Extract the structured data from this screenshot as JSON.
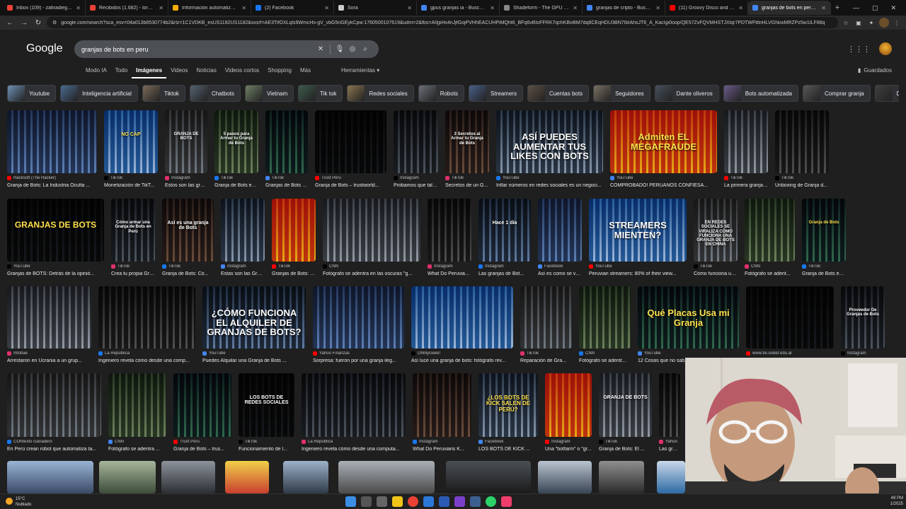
{
  "tabs": [
    {
      "title": "Inbox (109) - zafiradiego23@g",
      "color": "#ea4335",
      "active": false
    },
    {
      "title": "Recibidos (1.682) - lordgarza",
      "color": "#ea4335",
      "active": false
    },
    {
      "title": "Información automatizada de",
      "color": "#f9ab00",
      "active": false
    },
    {
      "title": "(2) Facebook",
      "color": "#1877f2",
      "active": false
    },
    {
      "title": "Sora",
      "color": "#cccccc",
      "active": false
    },
    {
      "title": "gpus granjas ia - Buscar con",
      "color": "#4285f4",
      "active": false
    },
    {
      "title": "Shadeform - The GPU Cloud",
      "color": "#888888",
      "active": false
    },
    {
      "title": "granjas de cripto - Buscar con",
      "color": "#4285f4",
      "active": false
    },
    {
      "title": "(11) Groovy Disco and R&B",
      "color": "#ff0000",
      "active": false
    },
    {
      "title": "granjas de bots en peru - Bus",
      "color": "#4285f4",
      "active": true
    }
  ],
  "toolbar": {
    "url": "google.com/search?sca_esv=04a013b6530774b2&rlz=1C1VDKB_esUS1182US1182&sxsrf=AE3TifOXLqls9WmcHs-gV_vbG5nGEykCpw:1760500107619&udm=2&fbs=AIIjpHx4nJjfGojPVHhEACUHPiMQht6_BFq6vBIoFFRK7qchKBv8lM7dq8CEqHDU3BN7IbIAhsJT8_A_KacIgi0oop/QE57ZvFQVMHSTJXlqr7PDTWFttlnHLVGNoxMRZPz5w1ILF88q"
  },
  "google": {
    "logo": "Google",
    "query": "granjas de bots en peru",
    "nav_tabs": [
      "Modo IA",
      "Todo",
      "Imágenes",
      "Videos",
      "Noticias",
      "Videos cortos",
      "Shopping",
      "Más"
    ],
    "active_tab": "Imágenes",
    "tools": "Herramientas",
    "saved": "Guardados"
  },
  "chips": [
    "Youtube",
    "Inteligencia artificial",
    "Tiktok",
    "Chatbots",
    "Vietnam",
    "Tik tok",
    "Redes sociales",
    "Robots",
    "Streamers",
    "Cuentas bots",
    "Seguidores",
    "Dante oliveros",
    "Bots automatizada",
    "Comprar granja",
    "De clics"
  ],
  "results": [
    [
      {
        "source": "Hacksoft (The Hacker)",
        "caption": "Granja de Bots: La Industria Oculta ...",
        "overlay": ""
      },
      {
        "source": "TikTok",
        "caption": "Monetización de TikT...",
        "overlay": "NO CAP"
      },
      {
        "source": "Instagram",
        "caption": "Estos son las granj...",
        "overlay": "GRANJA DE BOTS"
      },
      {
        "source": "TikTok",
        "caption": "Granja de Bots en ...",
        "overlay": "5 pasos para Armar tu Granja de Bots"
      },
      {
        "source": "TikTok",
        "caption": "Granjas de Bots e...",
        "overlay": ""
      },
      {
        "source": "Trust Peru",
        "caption": "Granja de Bots – trustworld...",
        "overlay": ""
      },
      {
        "source": "Instagram",
        "caption": "Probamos que tal f...",
        "overlay": ""
      },
      {
        "source": "TikTok",
        "caption": "Secretos de un G...",
        "overlay": "3 Secretos al Armar tu Granja de Bots"
      },
      {
        "source": "YouTube",
        "caption": "Inflar números en redes sociales es un negoci...",
        "overlay": "ASÍ PUEDES AUMENTAR TUS LIKES CON BOTS"
      },
      {
        "source": "YouTube",
        "caption": "COMPROBADO! PERUANOS CONFIESA...",
        "overlay": "Admiten EL MEGAFRAUDE"
      },
      {
        "source": "TikTok",
        "caption": "La primera granja ...",
        "overlay": ""
      },
      {
        "source": "TikTok",
        "caption": "Unboxing de Granja d...",
        "overlay": ""
      }
    ],
    [
      {
        "source": "YouTube",
        "caption": "Granjas de BOTS: Detrás de la opinió...",
        "overlay": "GRANJAS DE BOTS"
      },
      {
        "source": "TikTok",
        "caption": "Crea tu propia Gra...",
        "overlay": "Cómo armar una Granja de Bots en Perú"
      },
      {
        "source": "TikTok",
        "caption": "Granja de Bots: Có...",
        "overlay": "Así es una granja de Bots"
      },
      {
        "source": "Instagram",
        "caption": "Estas son las Gran...",
        "overlay": ""
      },
      {
        "source": "TikTok",
        "caption": "Granjas de Bots: D...",
        "overlay": ""
      },
      {
        "source": "CNN",
        "caption": "Fotógrafo se adentra en las oscuras \"g...",
        "overlay": ""
      },
      {
        "source": "Instagram",
        "caption": "What Do Peruvian...",
        "overlay": ""
      },
      {
        "source": "Instagram",
        "caption": "Las granjas de Bot...",
        "overlay": "Hace 1 día"
      },
      {
        "source": "Facebook",
        "caption": "Así es como se ve ...",
        "overlay": ""
      },
      {
        "source": "YouTube",
        "caption": "Peruvian streamers: 80% of their view...",
        "overlay": "STREAMERS MIENTEN?"
      },
      {
        "source": "TikTok",
        "caption": "Cómo funciona un...",
        "overlay": "EN REDES SOCIALES SE VIRALIZA CÓMO FUNCIONA UNA GRANJA DE BOTS EN CHINA"
      },
      {
        "source": "CNN",
        "caption": "Fotógrafo se adent...",
        "overlay": ""
      },
      {
        "source": "TikTok",
        "caption": "Granja de Bots en ...",
        "overlay": "Granja de Bots"
      }
    ],
    [
      {
        "source": "Infobae",
        "caption": "Arrestaron en Ucrania a un grup...",
        "overlay": ""
      },
      {
        "source": "La República",
        "caption": "Ingeniero revela cómo desde una comp...",
        "overlay": ""
      },
      {
        "source": "YouTube",
        "caption": "Puedes Alquilar una Granja de Bots ...",
        "overlay": "¿CÓMO FUNCIONA EL ALQUILER DE GRANJAS DE BOTS?"
      },
      {
        "source": "Yahoo Finanzas",
        "caption": "Sorpresa: fueron por una granja ileg...",
        "overlay": ""
      },
      {
        "source": "OhMyGeek!",
        "caption": "Así luce una granja de bots: fotógrafo rev...",
        "overlay": ""
      },
      {
        "source": "TikTok",
        "caption": "Reparación de Gra...",
        "overlay": ""
      },
      {
        "source": "CNN",
        "caption": "Fotógrafo se adentr...",
        "overlay": ""
      },
      {
        "source": "YouTube",
        "caption": "12 Cosas que no sab...",
        "overlay": "Qué Placas Usa mi Granja"
      },
      {
        "source": "www.fie.undef.edu.ar",
        "caption": "",
        "overlay": ""
      },
      {
        "source": "Instagram",
        "caption": "",
        "overlay": "Proveedor De Granjas de Bots"
      }
    ],
    [
      {
        "source": "CONtexto Ganadero",
        "caption": "En Perú crean robot que automatiza ta...",
        "overlay": ""
      },
      {
        "source": "CNN",
        "caption": "Fotógrafo se adentra ...",
        "overlay": ""
      },
      {
        "source": "Trust Peru",
        "caption": "Granja de Bots – trus...",
        "overlay": ""
      },
      {
        "source": "TikTok",
        "caption": "Funcionamiento de l...",
        "overlay": "LOS BOTS DE REDES SOCIALES"
      },
      {
        "source": "La República",
        "caption": "Ingeniero revela cómo desde una computa...",
        "overlay": ""
      },
      {
        "source": "Instagram",
        "caption": "What Do Peruvians K...",
        "overlay": ""
      },
      {
        "source": "Facebook",
        "caption": "LOS BOTS DE KICK ...",
        "overlay": "¿LOS BOTS DE KICK SALEN DE PERÚ?"
      },
      {
        "source": "Instagram",
        "caption": "Una \"botfarm\" o \"gr...",
        "overlay": ""
      },
      {
        "source": "TikTok",
        "caption": "Granja de Bots: El ...",
        "overlay": "GRANJA DE BOTS"
      },
      {
        "source": "Yahoo",
        "caption": "Las gran...",
        "overlay": ""
      }
    ]
  ],
  "taskbar": {
    "temp": "15°C",
    "weather": "Nublado",
    "time": "49 PM",
    "date": "1/2025"
  },
  "colors": {
    "bg": "#1f1f1f",
    "text": "#e8eaed",
    "accent": "#8ab4f8"
  }
}
